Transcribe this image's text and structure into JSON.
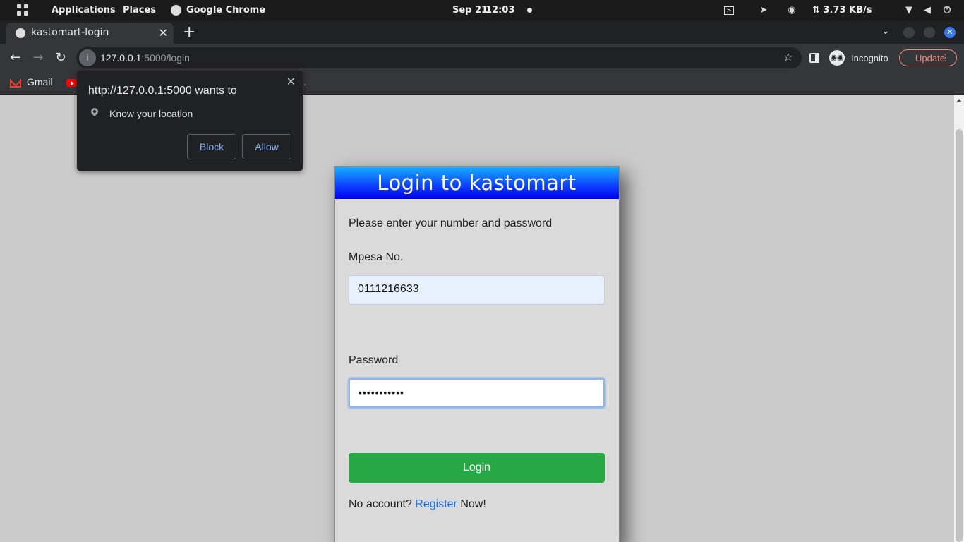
{
  "system_bar": {
    "applications": "Applications",
    "places": "Places",
    "active_app": "Google Chrome",
    "date": "Sep 21",
    "time": "12:03",
    "net_speed": "⇅ 3.73 KB/s",
    "icons": [
      "grid-icon",
      "chrome-icon",
      "terminal-icon",
      "telegram-icon",
      "record-icon",
      "wifi-icon",
      "volume-icon",
      "power-icon"
    ]
  },
  "browser": {
    "tab_title": "kastomart-login",
    "url_host": "127.0.0.1",
    "url_path": ":5000/login",
    "incognito_label": "Incognito",
    "update_label": "Update",
    "bookmarks": [
      {
        "label": "Gmail",
        "icon": "gmail-icon"
      },
      {
        "label": "",
        "icon": "youtube-icon"
      }
    ],
    "bookmark_overflow": "."
  },
  "permission_popup": {
    "title": "http://127.0.0.1:5000 wants to",
    "permission": "Know your location",
    "block_label": "Block",
    "allow_label": "Allow"
  },
  "login": {
    "heading": "Login to kastomart",
    "instructions": "Please enter your number and password",
    "mpesa_label": "Mpesa No.",
    "mpesa_value": "0111216633",
    "password_label": "Password",
    "password_value": "•••••••••••",
    "login_button": "Login",
    "no_account": "No account?",
    "register_link": "Register",
    "now": "Now!"
  },
  "colors": {
    "login_button": "#28a745",
    "header_gradient_top": "#19b1ff",
    "header_gradient_bottom": "#0000ee",
    "link": "#1a73e8",
    "update_accent": "#f28b82"
  }
}
